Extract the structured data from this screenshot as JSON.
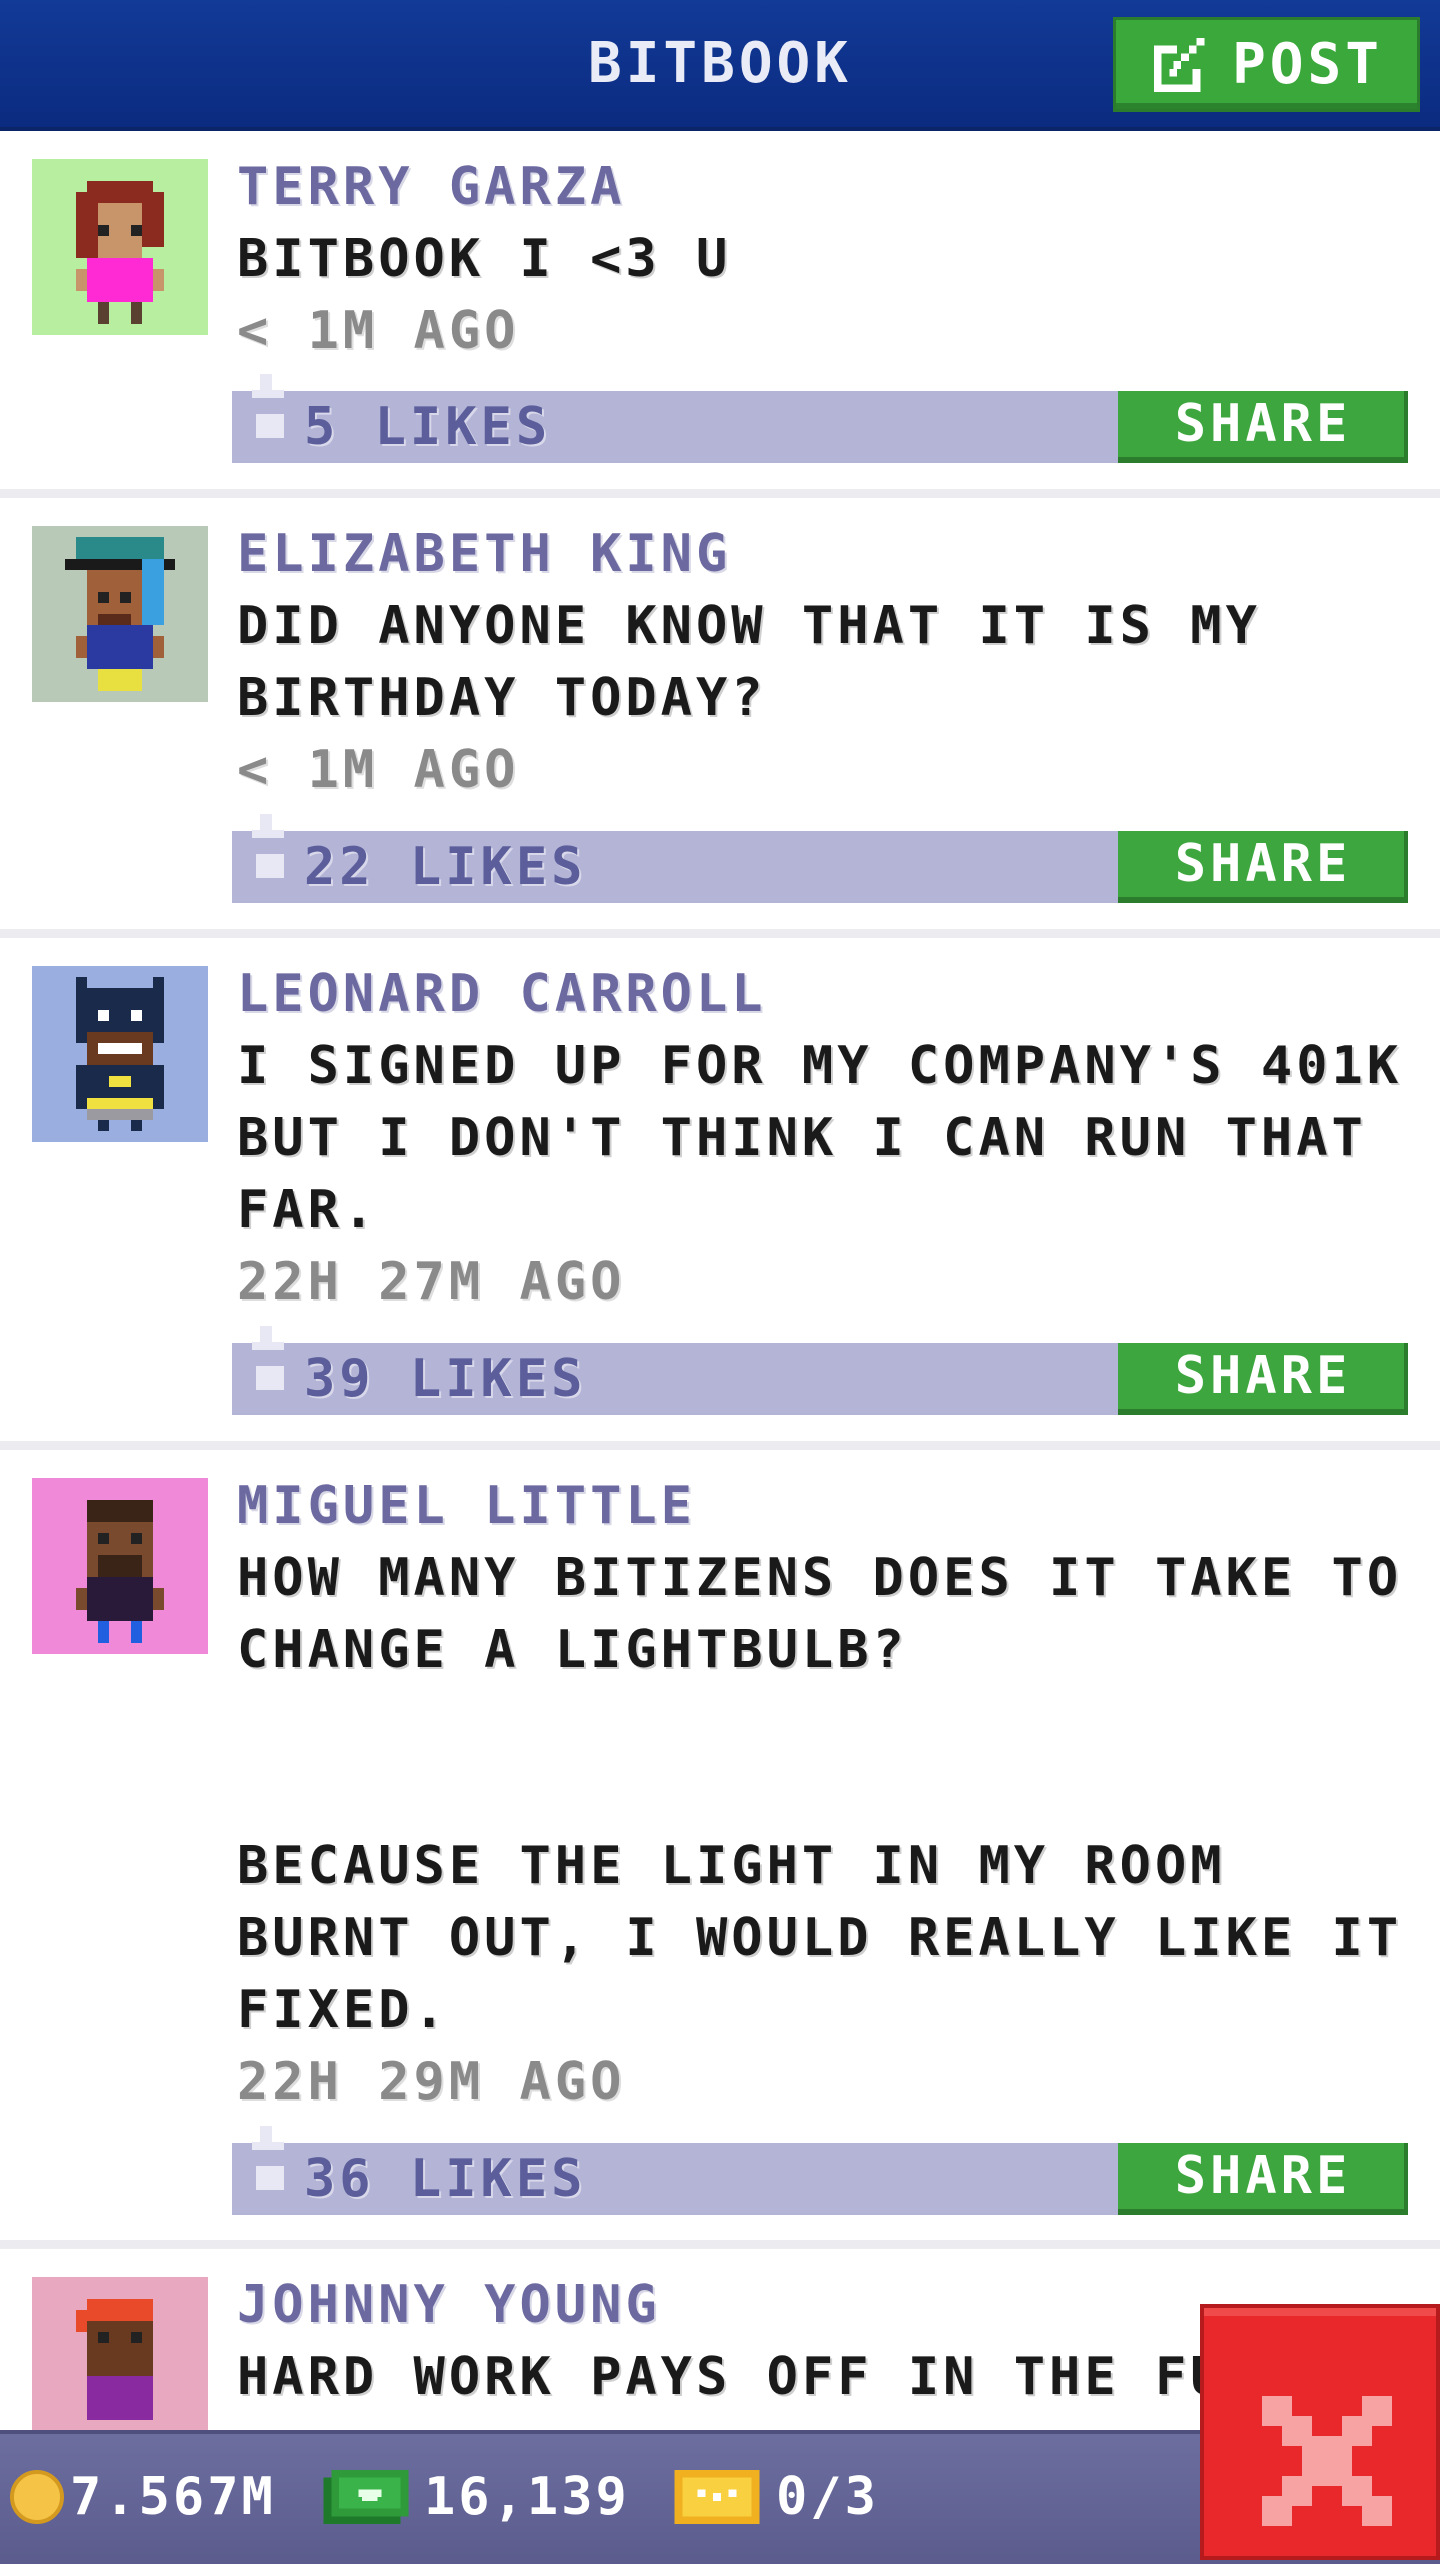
{
  "header": {
    "title": "BITBOOK",
    "post_label": "POST"
  },
  "posts": [
    {
      "name": "TERRY GARZA",
      "text": "BITBOOK I <3 U",
      "time": "< 1M AGO",
      "likes": "5 LIKES",
      "share": "SHARE",
      "avatar_bg": "#b8eea0"
    },
    {
      "name": "ELIZABETH KING",
      "text": "DID ANYONE KNOW THAT IT IS MY\nBIRTHDAY TODAY?",
      "time": "< 1M AGO",
      "likes": "22 LIKES",
      "share": "SHARE",
      "avatar_bg": "#b8c9b8"
    },
    {
      "name": "LEONARD CARROLL",
      "text": "I SIGNED UP FOR MY COMPANY'S 401K\nBUT I DON'T THINK I CAN RUN THAT\nFAR.",
      "time": "22H 27M AGO",
      "likes": "39 LIKES",
      "share": "SHARE",
      "avatar_bg": "#9aaee0"
    },
    {
      "name": "MIGUEL LITTLE",
      "text": "HOW MANY BITIZENS DOES IT TAKE TO\nCHANGE A LIGHTBULB?\n\n\nBECAUSE THE LIGHT IN MY ROOM\nBURNT OUT, I WOULD REALLY LIKE IT\nFIXED.",
      "time": "22H 29M AGO",
      "likes": "36 LIKES",
      "share": "SHARE",
      "avatar_bg": "#f08ad8"
    },
    {
      "name": "JOHNNY YOUNG",
      "text": "HARD WORK PAYS OFF IN THE FU",
      "avatar_bg": "#e8a8c0"
    }
  ],
  "status": {
    "coins": "7.567M",
    "bux": "16,139",
    "tickets": "0/3"
  },
  "colors": {
    "header": "#123a97",
    "green": "#3aa83b",
    "like_bar": "#b3b4d6",
    "name": "#6b69a0",
    "close": "#e8282a"
  }
}
